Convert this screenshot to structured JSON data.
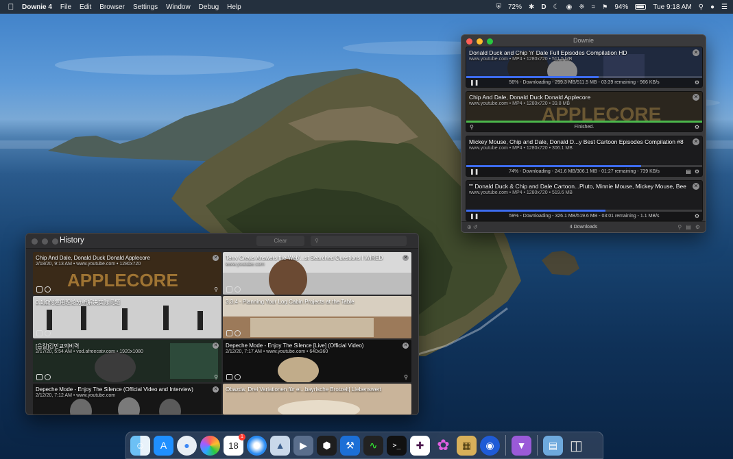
{
  "menubar": {
    "app_name": "Downie 4",
    "menus": [
      "File",
      "Edit",
      "Browser",
      "Settings",
      "Window",
      "Debug",
      "Help"
    ],
    "status": {
      "shield_percent": "72%",
      "battery_percent": "94%",
      "clock": "Tue 9:18 AM"
    }
  },
  "downie": {
    "window_title": "Downie",
    "footer_label": "4 Downloads",
    "items": [
      {
        "title": "Donald Duck and Chip 'n' Dale Full Episodes Compilation HD",
        "meta": "www.youtube.com • MP4 • 1280x720 • 511.5 MB",
        "progress": 0.56,
        "state": "downloading",
        "status": "56% - Downloading - 299.3 MB/511.5 MB - 03:39 remaining - 966 KB/s"
      },
      {
        "title": "Chip And Dale, Donald Duck Donald Applecore",
        "meta": "www.youtube.com • MP4 • 1280x720 • 39.8 MB",
        "progress": 1.0,
        "state": "finished",
        "status": "Finished."
      },
      {
        "title": "Mickey Mouse, Chip and Dale, Donald D...y Best Cartoon Episodes Compilation #8",
        "meta": "www.youtube.com • MP4 • 1280x720 • 306.1 MB",
        "progress": 0.74,
        "state": "downloading",
        "status": "74% - Downloading - 241.6 MB/306.1 MB - 01:27 remaining - 739 KB/s"
      },
      {
        "title": "\"\" Donald Duck & Chip and Dale Cartoon...Pluto, Minnie Mouse, Mickey Mouse, Bee",
        "meta": "www.youtube.com • MP4 • 1280x720 • 519.6 MB",
        "progress": 0.59,
        "state": "downloading",
        "status": "59% - Downloading - 326.1 MB/519.6 MB - 03:01 remaining - 1.1 MB/s"
      }
    ]
  },
  "history": {
    "window_title": "History",
    "clear_label": "Clear",
    "cards": [
      {
        "title": "Chip And Dale, Donald Duck Donald Applecore",
        "meta": "2/18/20, 9:13 AM • www.youtube.com • 1280x720",
        "thumb": "applecore",
        "show_search": true
      },
      {
        "title": "Terry Crews Answers the Web'...st Searched Questions | WIRED",
        "meta": "www.youtube.com",
        "thumb": "terry",
        "show_search": false
      },
      {
        "title": "0.1如何運用理论分析解决实际问题",
        "meta": "",
        "thumb": "business",
        "show_search": false
      },
      {
        "title": "3.3.4 - Planning Your Log Cabin Projects at the Table",
        "meta": "",
        "thumb": "cabin",
        "show_search": false
      },
      {
        "title": "[음킬]김민교의비력",
        "meta": "2/17/20, 5:54 AM • vod.afreecatv.com • 1920x1080",
        "thumb": "afreeca",
        "show_search": true
      },
      {
        "title": "Depeche Mode - Enjoy The Silence  [Live] (Official Video)",
        "meta": "2/12/20, 7:17 AM • www.youtube.com • 640x360",
        "thumb": "depeche_live",
        "show_search": true
      },
      {
        "title": "Depeche Mode - Enjoy The Silence (Official Video and Interview)",
        "meta": "2/12/20, 7:12 AM • www.youtube.com",
        "thumb": "depeche",
        "show_search": false
      },
      {
        "title": "Obazda: Drei Variationen für ei...bayrische Brotzeit| Liebenswert",
        "meta": "",
        "thumb": "obazda",
        "show_search": false
      }
    ]
  },
  "dock": {
    "calendar_day": "18",
    "calendar_badge": "1"
  },
  "colors": {
    "progress_blue": "#3d6cf0",
    "finished_green": "#4cb84c"
  }
}
